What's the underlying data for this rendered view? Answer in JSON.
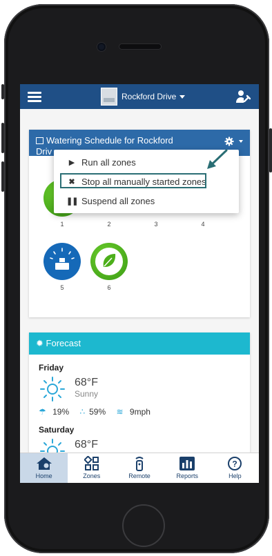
{
  "header": {
    "site_name": "Rockford Drive"
  },
  "schedule": {
    "title_line1": "Watering Schedule for Rockford",
    "title_line2": "Driv",
    "zones": [
      {
        "num": "1",
        "color": "green",
        "visible": "partial"
      },
      {
        "num": "2",
        "color": "none"
      },
      {
        "num": "3",
        "color": "none"
      },
      {
        "num": "4",
        "color": "none"
      },
      {
        "num": "5",
        "color": "blue"
      },
      {
        "num": "6",
        "color": "green"
      }
    ]
  },
  "dropdown": {
    "items": [
      {
        "label": "Run all zones",
        "icon": "play-icon"
      },
      {
        "label": "Stop all manually started zones",
        "icon": "x-icon"
      },
      {
        "label": "Suspend all zones",
        "icon": "pause-icon"
      }
    ]
  },
  "forecast": {
    "title": "Forecast",
    "days": [
      {
        "day": "Friday",
        "temp": "68°F",
        "condition": "Sunny",
        "precip": "19%",
        "humidity": "59%",
        "wind": "9mph"
      },
      {
        "day": "Saturday",
        "temp": "68°F"
      }
    ]
  },
  "nav": {
    "items": [
      "Home",
      "Zones",
      "Remote",
      "Reports",
      "Help"
    ]
  },
  "colors": {
    "topbar": "#1f4f86",
    "schedule_header": "#2d6aa8",
    "forecast_header": "#1db8cf",
    "zone_green": "#4caf1a",
    "zone_blue": "#1569b8",
    "highlight_border": "#2a6e74"
  }
}
